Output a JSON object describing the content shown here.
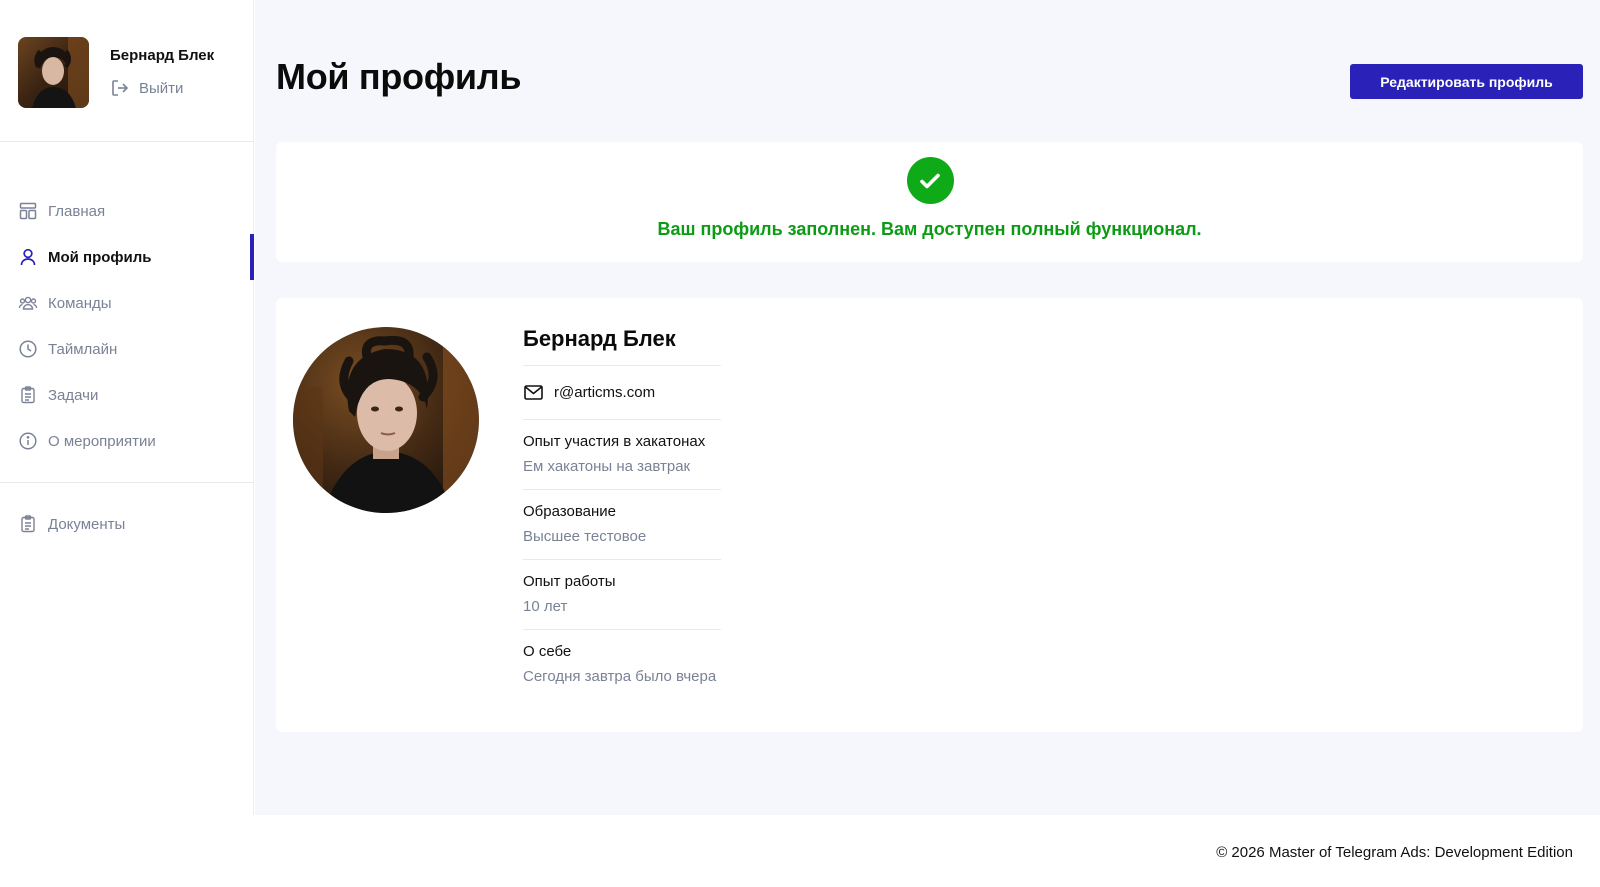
{
  "user": {
    "name": "Бернард Блек",
    "logout_label": "Выйти"
  },
  "nav": {
    "items": [
      {
        "label": "Главная",
        "icon": "dashboard-icon"
      },
      {
        "label": "Мой профиль",
        "icon": "user-icon",
        "active": true
      },
      {
        "label": "Команды",
        "icon": "team-icon"
      },
      {
        "label": "Таймлайн",
        "icon": "clock-icon"
      },
      {
        "label": "Задачи",
        "icon": "clipboard-icon"
      },
      {
        "label": "О мероприятии",
        "icon": "info-icon"
      }
    ],
    "secondary": [
      {
        "label": "Документы",
        "icon": "document-icon"
      }
    ]
  },
  "page": {
    "title": "Мой профиль",
    "edit_button": "Редактировать профиль"
  },
  "notice": {
    "text": "Ваш профиль заполнен. Вам доступен полный функционал."
  },
  "profile": {
    "name": "Бернард Блек",
    "email": "r@articms.com",
    "fields": [
      {
        "label": "Опыт участия в хакатонах",
        "value": "Ем хакатоны на завтрак"
      },
      {
        "label": "Образование",
        "value": "Высшее тестовое"
      },
      {
        "label": "Опыт работы",
        "value": "10 лет"
      },
      {
        "label": "О себе",
        "value": "Сегодня завтра было вчера"
      }
    ]
  },
  "footer": {
    "copyright": "© 2026 Master of Telegram Ads: Development Edition"
  },
  "colors": {
    "accent": "#2a22b8",
    "success": "#0c9c14",
    "muted": "#7a8296",
    "background": "#f5f7fc"
  }
}
